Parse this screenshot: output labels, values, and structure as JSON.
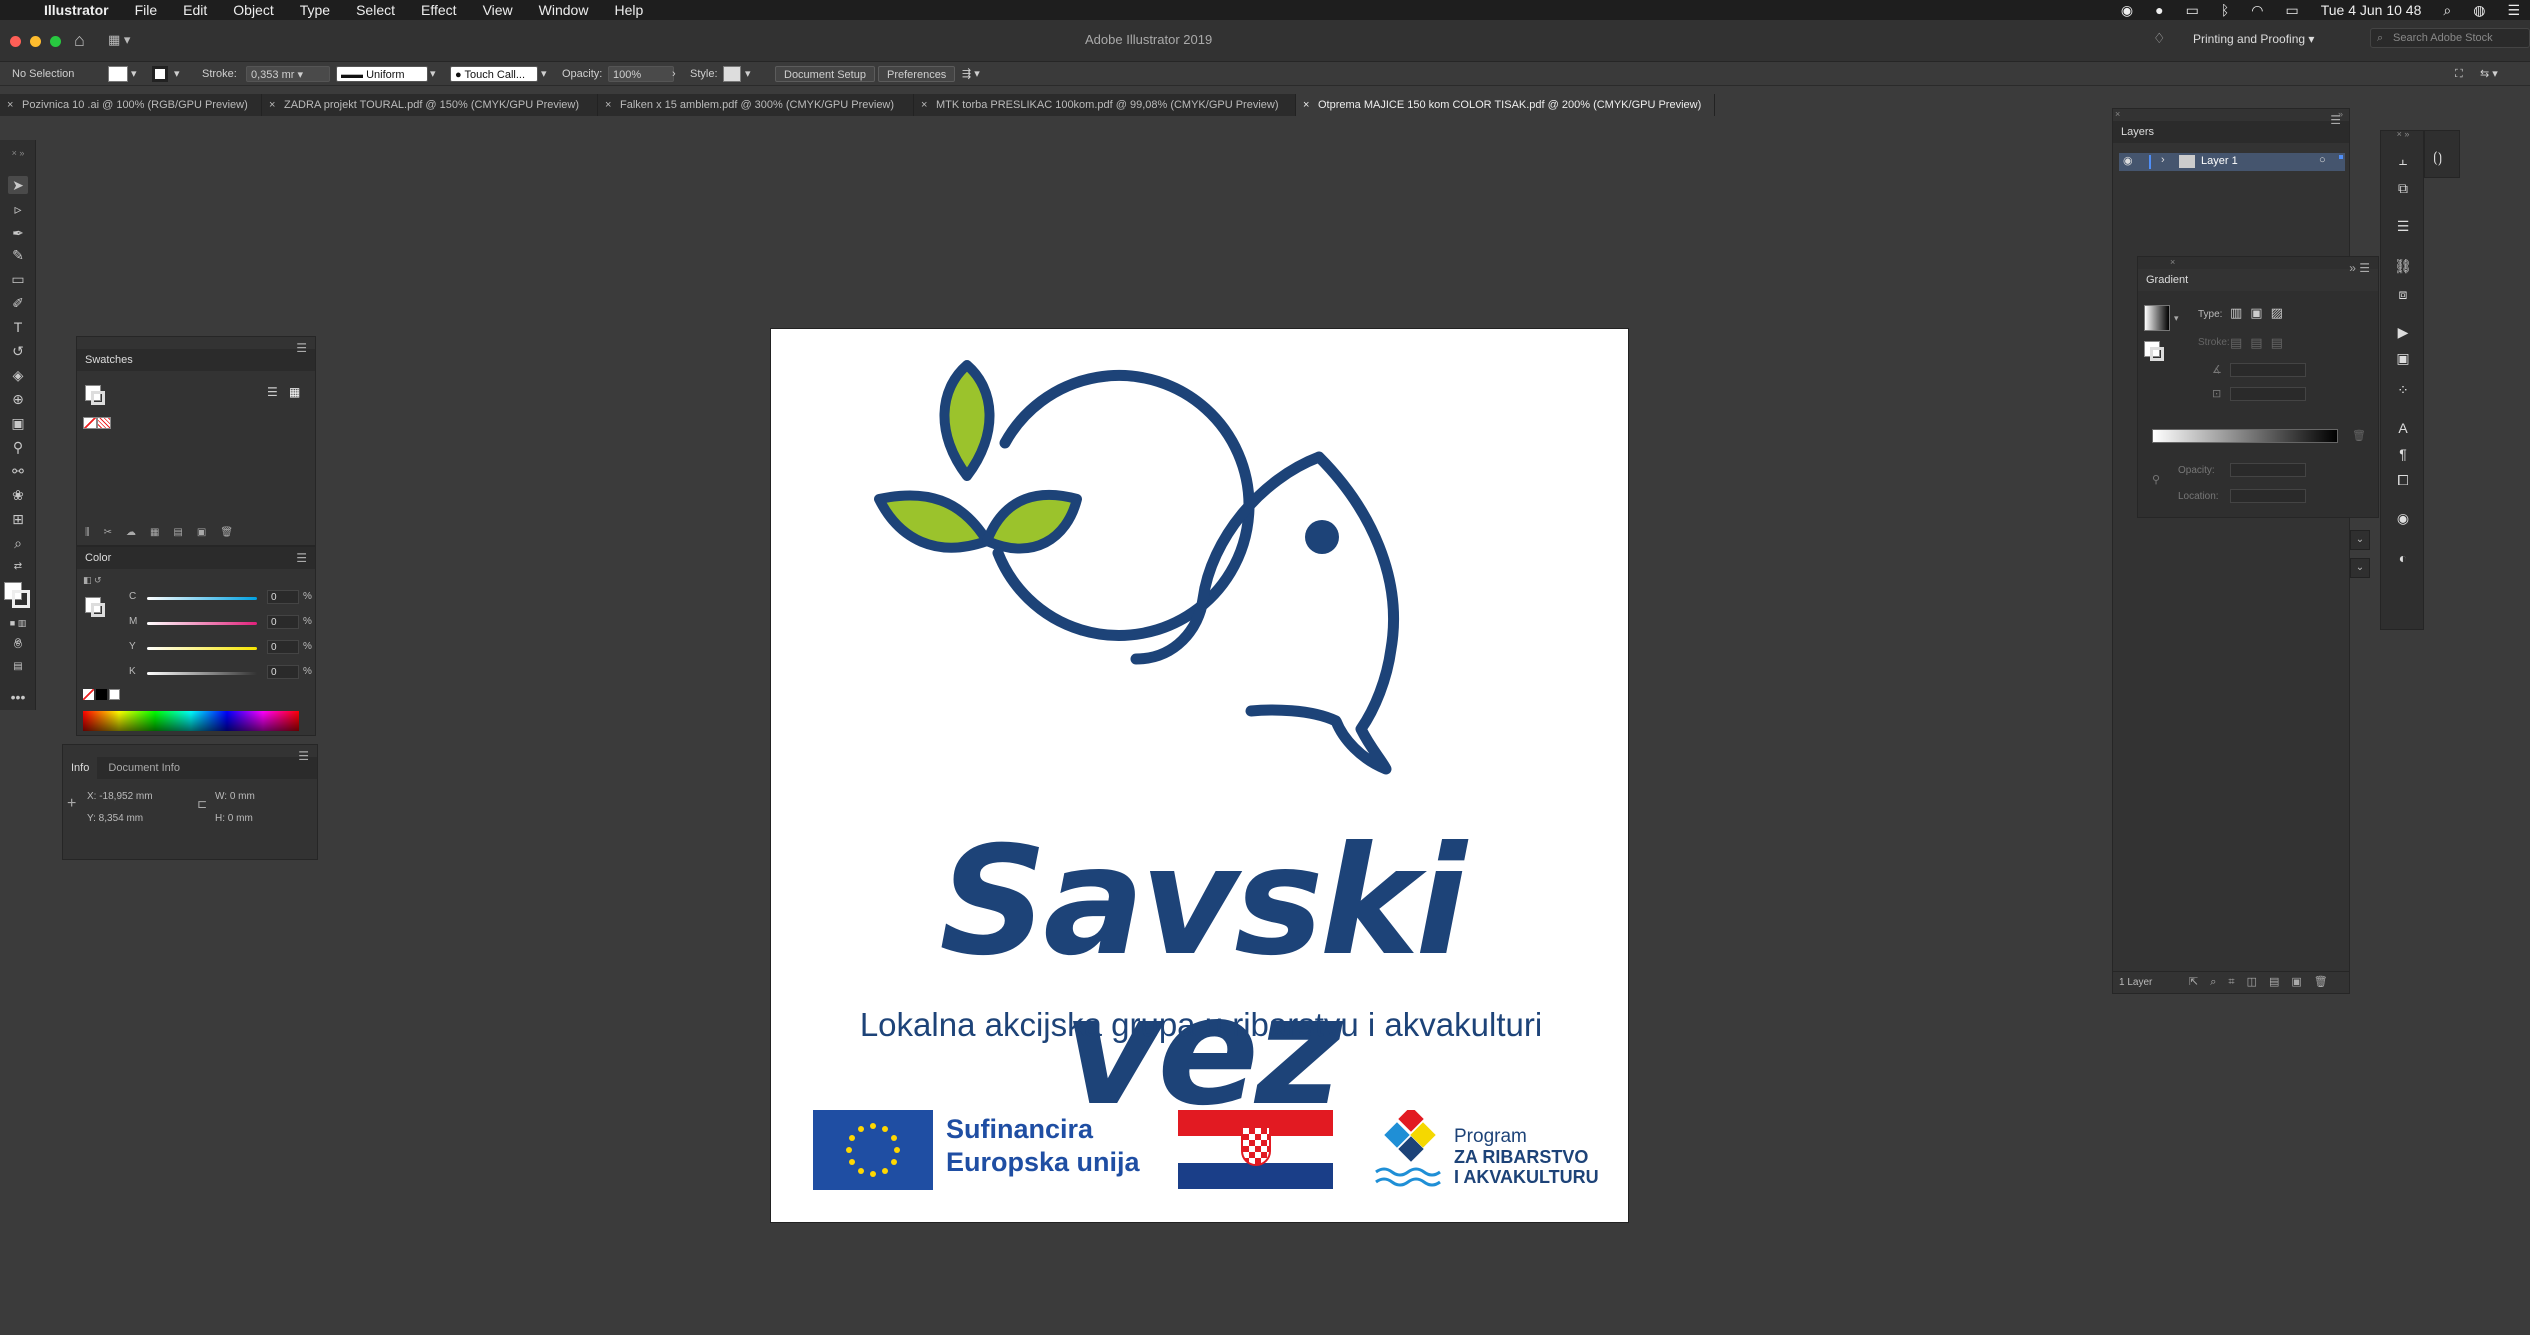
{
  "menu": {
    "apple": "",
    "app": "Illustrator",
    "items": [
      "File",
      "Edit",
      "Object",
      "Type",
      "Select",
      "Effect",
      "View",
      "Window",
      "Help"
    ],
    "clock": "Tue 4 Jun  10 48"
  },
  "title": "Adobe Illustrator 2019",
  "workspace": "Printing and Proofing",
  "stock_placeholder": "Search Adobe Stock",
  "control": {
    "selection": "No Selection",
    "stroke_label": "Stroke:",
    "stroke_value": "0,353 mr",
    "profile": "Uniform",
    "brush": "Touch Call...",
    "opacity_label": "Opacity:",
    "opacity_value": "100%",
    "style_label": "Style:",
    "doc_setup": "Document Setup",
    "preferences": "Preferences"
  },
  "tabs": [
    {
      "label": "Pozivnica 10 .ai @ 100% (RGB/GPU Preview)"
    },
    {
      "label": "ZADRA projekt TOURAL.pdf @ 150% (CMYK/GPU Preview)"
    },
    {
      "label": "Falken x 15 amblem.pdf @ 300% (CMYK/GPU Preview)"
    },
    {
      "label": "MTK torba PRESLIKAC 100kom.pdf @ 99,08% (CMYK/GPU Preview)"
    },
    {
      "label": "Otprema MAJICE 150 kom COLOR TISAK.pdf @ 200% (CMYK/GPU Preview)"
    }
  ],
  "swatches": {
    "title": "Swatches"
  },
  "color": {
    "title": "Color",
    "channels": [
      {
        "label": "C",
        "value": "0",
        "color": "#00a0e0"
      },
      {
        "label": "M",
        "value": "0",
        "color": "#e0207a"
      },
      {
        "label": "Y",
        "value": "0",
        "color": "#f5e400"
      },
      {
        "label": "K",
        "value": "0",
        "color": "#8a8a8a"
      }
    ],
    "pct": "%"
  },
  "info": {
    "tab1": "Info",
    "tab2": "Document Info",
    "x": "X:  -18,952 mm",
    "y": "Y:  8,354 mm",
    "w": "W:  0 mm",
    "h": "H:  0 mm"
  },
  "layers": {
    "title": "Layers",
    "layer": "Layer 1",
    "count": "1 Layer"
  },
  "gradient": {
    "title": "Gradient",
    "type": "Type:",
    "stroke": "Stroke:",
    "opacity": "Opacity:",
    "location": "Location:"
  },
  "logo": {
    "brand": "Savski vez",
    "subtitle": "Lokalna akcijska grupa u ribarstvu i akvakulturi",
    "eu1": "Sufinancira",
    "eu2": "Europska unija",
    "prog1": "Program",
    "prog2": "ZA RIBARSTVO",
    "prog3": "I AKVAKULTURU"
  },
  "colors": {
    "navy": "#1d4378",
    "green": "#9bc32c",
    "eu_blue": "#1f4ea3",
    "eu_star": "#ffd700",
    "hr_red": "#e21a22",
    "hr_blue": "#1a3e88"
  }
}
